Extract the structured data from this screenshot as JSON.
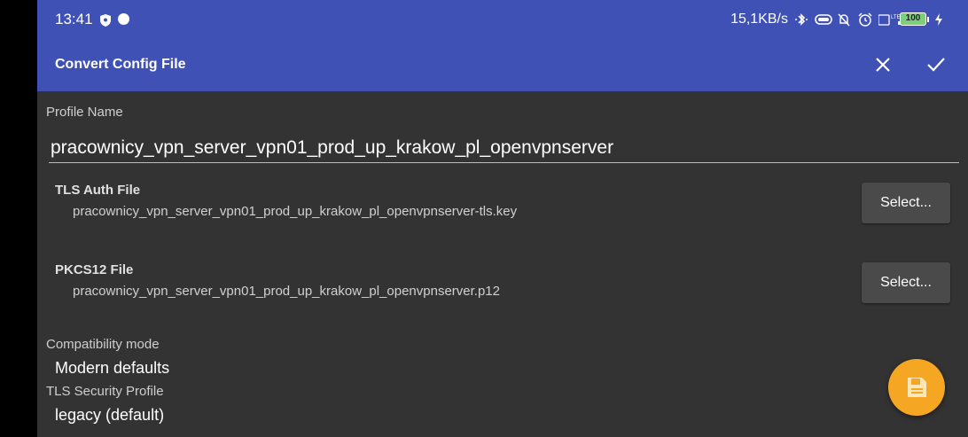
{
  "status_bar": {
    "time": "13:41",
    "net_speed": "15,1KB/s",
    "network_type": "LTE",
    "battery": "100"
  },
  "toolbar": {
    "title": "Convert Config File"
  },
  "form": {
    "profile_name_label": "Profile Name",
    "profile_name_value": "pracownicy_vpn_server_vpn01_prod_up_krakow_pl_openvpnserver",
    "tls_auth": {
      "title": "TLS Auth File",
      "filename": "pracownicy_vpn_server_vpn01_prod_up_krakow_pl_openvpnserver-tls.key",
      "button": "Select..."
    },
    "pkcs12": {
      "title": "PKCS12 File",
      "filename": "pracownicy_vpn_server_vpn01_prod_up_krakow_pl_openvpnserver.p12",
      "button": "Select..."
    },
    "compat_label": "Compatibility mode",
    "compat_value": "Modern defaults",
    "tls_profile_label": "TLS Security Profile",
    "tls_profile_value": "legacy (default)"
  },
  "colors": {
    "toolbar": "#3f51b5",
    "background": "#333333",
    "fab": "#f5a623"
  },
  "icons": {
    "close": "close-icon",
    "confirm": "check-icon",
    "fab": "save-icon"
  }
}
